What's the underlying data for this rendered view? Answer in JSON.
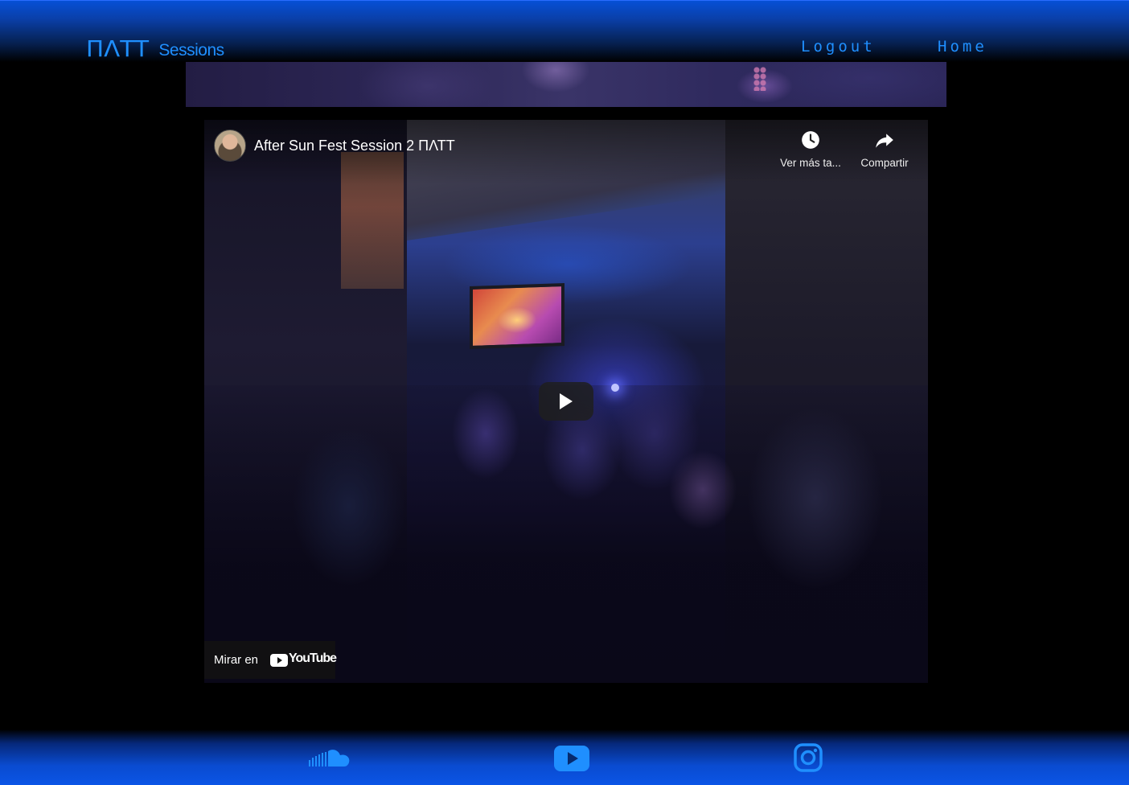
{
  "header": {
    "logo_mark": "ΠΛΤΤ",
    "logo_sub": "Sessions",
    "nav": {
      "logout": "Logout",
      "home": "Home"
    }
  },
  "video": {
    "title": "After Sun Fest Session 2 ΠΛΤΤ",
    "actions": {
      "watch_later": "Ver más ta...",
      "share": "Compartir"
    },
    "watch_on": "Mirar en",
    "watch_on_brand": "YouTube"
  },
  "footer": {
    "icons": [
      "soundcloud-icon",
      "youtube-icon",
      "instagram-icon"
    ]
  },
  "colors": {
    "accent": "#1f8fff",
    "header_blue": "#0650d6",
    "footer_blue": "#0b55e6",
    "background": "#000000"
  }
}
